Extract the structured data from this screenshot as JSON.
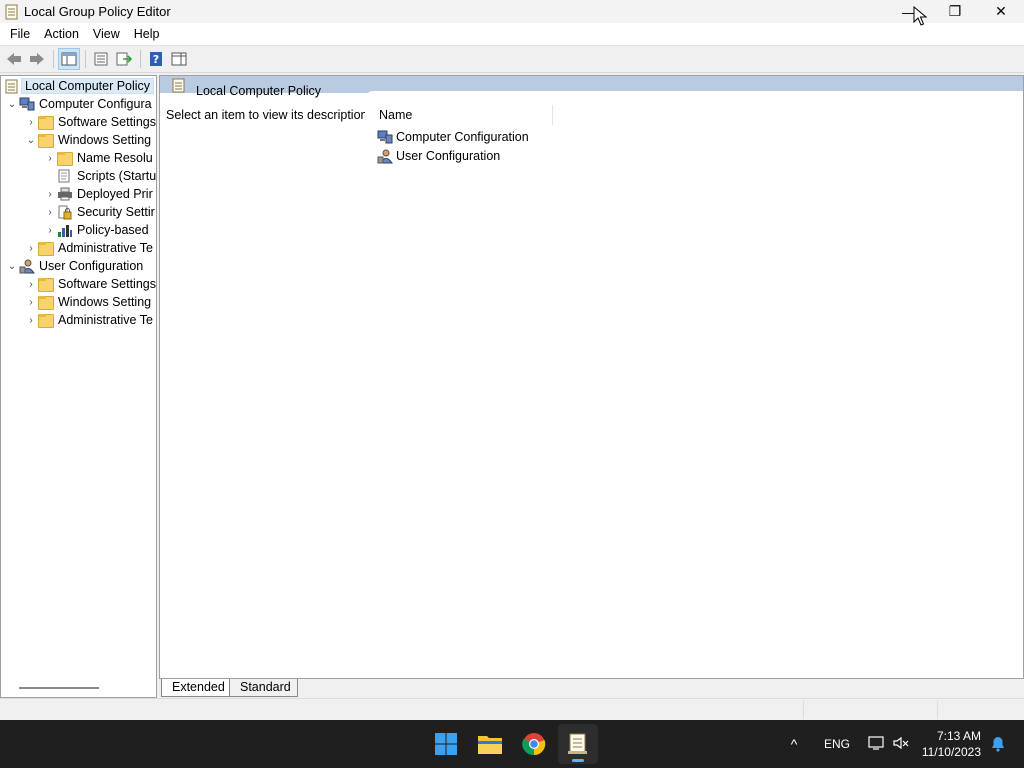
{
  "window": {
    "title": "Local Group Policy Editor",
    "controls": {
      "minimize": "—",
      "maximize": "❐",
      "close": "✕"
    }
  },
  "menu": [
    "File",
    "Action",
    "View",
    "Help"
  ],
  "toolbar": {
    "icons": [
      "back-arrow-icon",
      "forward-arrow-icon",
      "show-hide-tree-icon",
      "properties-icon",
      "export-list-icon",
      "help-icon",
      "show-hide-action-pane-icon"
    ]
  },
  "tree": {
    "root": "Local Computer Policy",
    "items": [
      {
        "label": "Computer Configura",
        "level": 1,
        "expanded": true,
        "icon": "computer-icon"
      },
      {
        "label": "Software Settings",
        "level": 2,
        "expanded": false,
        "icon": "folder-icon"
      },
      {
        "label": "Windows Setting",
        "level": 2,
        "expanded": true,
        "icon": "folder-icon"
      },
      {
        "label": "Name Resolu",
        "level": 3,
        "expanded": false,
        "icon": "folder-icon"
      },
      {
        "label": "Scripts (Startu",
        "level": 3,
        "expanded": null,
        "icon": "script-icon"
      },
      {
        "label": "Deployed Prir",
        "level": 3,
        "expanded": false,
        "icon": "printer-icon"
      },
      {
        "label": "Security Settir",
        "level": 3,
        "expanded": false,
        "icon": "security-icon"
      },
      {
        "label": "Policy-based ",
        "level": 3,
        "expanded": false,
        "icon": "qos-chart-icon"
      },
      {
        "label": "Administrative Te",
        "level": 2,
        "expanded": false,
        "icon": "folder-icon"
      },
      {
        "label": "User Configuration",
        "level": 1,
        "expanded": true,
        "icon": "user-icon"
      },
      {
        "label": "Software Settings",
        "level": 2,
        "expanded": false,
        "icon": "folder-icon"
      },
      {
        "label": "Windows Setting",
        "level": 2,
        "expanded": false,
        "icon": "folder-icon"
      },
      {
        "label": "Administrative Te",
        "level": 2,
        "expanded": false,
        "icon": "folder-icon"
      }
    ]
  },
  "right_pane": {
    "header_title": "Local Computer Policy",
    "description": "Select an item to view its description.",
    "column_name": "Name",
    "items": [
      {
        "label": "Computer Configuration",
        "icon": "computer-icon"
      },
      {
        "label": "User Configuration",
        "icon": "user-icon"
      }
    ]
  },
  "tabs": {
    "extended": "Extended",
    "standard": "Standard",
    "selected": "Extended"
  },
  "taskbar": {
    "apps": [
      "windows-start-icon",
      "file-explorer-icon",
      "chrome-icon",
      "group-policy-editor-icon"
    ],
    "tray": {
      "chevron": "^",
      "language": "ENG"
    },
    "time": "7:13 AM",
    "date": "11/10/2023"
  },
  "colors": {
    "header_band": "#b9cbe0",
    "taskbar": "#1f1f1f",
    "selection": "#d9e9f7",
    "folder": "#f6d36b"
  }
}
